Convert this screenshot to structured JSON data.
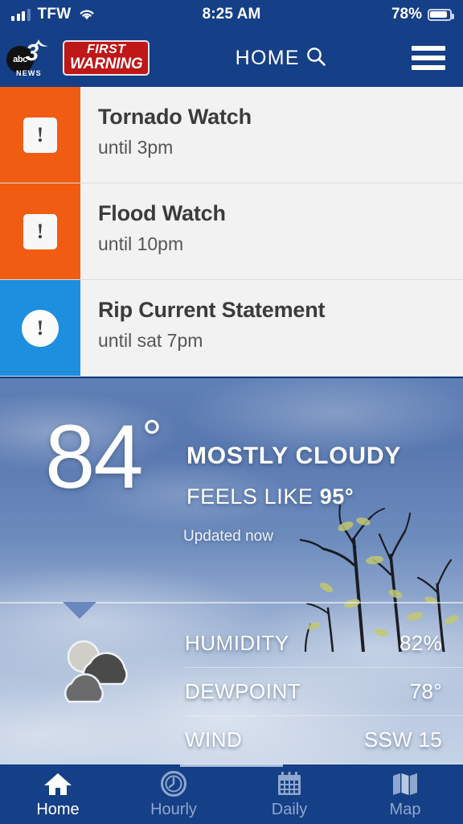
{
  "status_bar": {
    "carrier": "TFW",
    "time": "8:25 AM",
    "battery_percent": "78%",
    "signal_icon": "signal-bars-icon",
    "wifi_icon": "wifi-icon",
    "battery_icon": "battery-icon"
  },
  "header": {
    "title": "HOME",
    "search_icon": "search-icon",
    "menu_icon": "hamburger-menu-icon",
    "logo": {
      "network": "abc",
      "channel": "3",
      "news": "NEWS",
      "badge_line1": "FIRST",
      "badge_line2": "WARNING",
      "badge_color": "#c01718"
    }
  },
  "alerts": [
    {
      "title": "Tornado Watch",
      "subtitle": "until 3pm",
      "color": "#ef5c12",
      "icon": "exclamation-square-icon",
      "icon_shape": "square",
      "glyph": "!"
    },
    {
      "title": "Flood Watch",
      "subtitle": "until 10pm",
      "color": "#ef5c12",
      "icon": "exclamation-square-icon",
      "icon_shape": "square",
      "glyph": "!"
    },
    {
      "title": "Rip Current Statement",
      "subtitle": "until sat 7pm",
      "color": "#1e8ede",
      "icon": "exclamation-circle-icon",
      "icon_shape": "circle",
      "glyph": "!"
    }
  ],
  "current": {
    "temperature": "84",
    "degree": "°",
    "condition": "MOSTLY CLOUDY",
    "feels_like_label": "FEELS LIKE",
    "feels_like_value": "95°",
    "updated": "Updated now",
    "condition_icon": "mostly-cloudy-icon"
  },
  "details": [
    {
      "label": "HUMIDITY",
      "value": "82%"
    },
    {
      "label": "DEWPOINT",
      "value": "78°"
    },
    {
      "label": "WIND",
      "value": "SSW 15"
    }
  ],
  "nav": [
    {
      "label": "Home",
      "icon": "home-icon",
      "active": true
    },
    {
      "label": "Hourly",
      "icon": "clock-icon",
      "active": false
    },
    {
      "label": "Daily",
      "icon": "calendar-icon",
      "active": false
    },
    {
      "label": "Map",
      "icon": "map-icon",
      "active": false
    }
  ],
  "theme": {
    "header_blue": "#153f86",
    "alert_orange": "#ef5c12",
    "alert_blue": "#1e8ede",
    "alert_bg": "#f2f2f2"
  }
}
